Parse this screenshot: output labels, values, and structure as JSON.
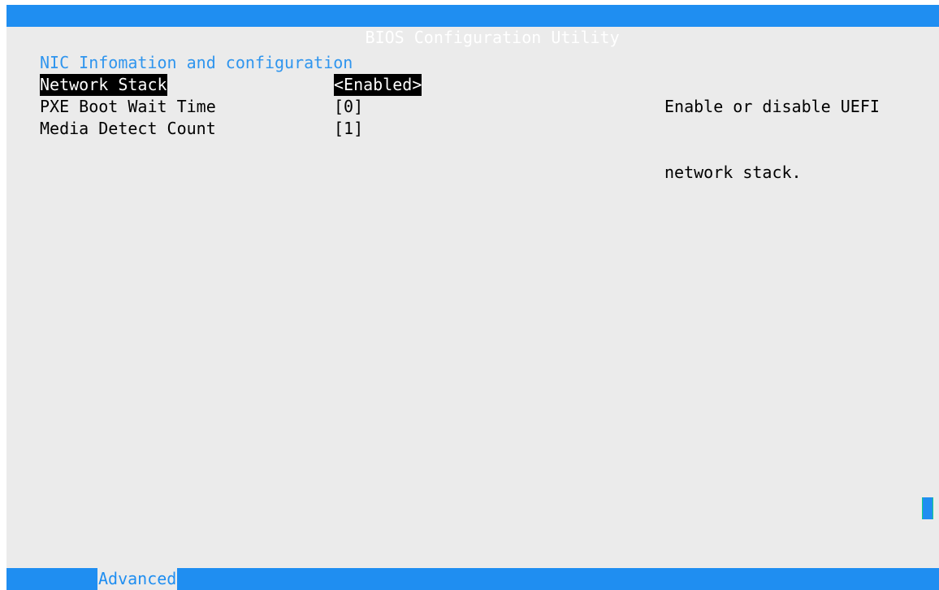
{
  "title_bar": {
    "title": "BIOS Configuration Utility"
  },
  "section": {
    "title": "NIC Infomation and configuration"
  },
  "settings": [
    {
      "label": "Network Stack",
      "value": "<Enabled>",
      "selected": true
    },
    {
      "label": "PXE Boot Wait Time",
      "value": "[0]",
      "selected": false
    },
    {
      "label": "Media Detect Count",
      "value": "[1]",
      "selected": false
    }
  ],
  "help": {
    "lines": [
      "Enable or disable UEFI",
      "network stack."
    ]
  },
  "bottom_bar": {
    "active_tab": "Advanced"
  },
  "colors": {
    "accent_blue": "#1f8ef1",
    "background": "#ebebeb",
    "selection_bg": "#000000",
    "selection_fg": "#ffffff"
  }
}
